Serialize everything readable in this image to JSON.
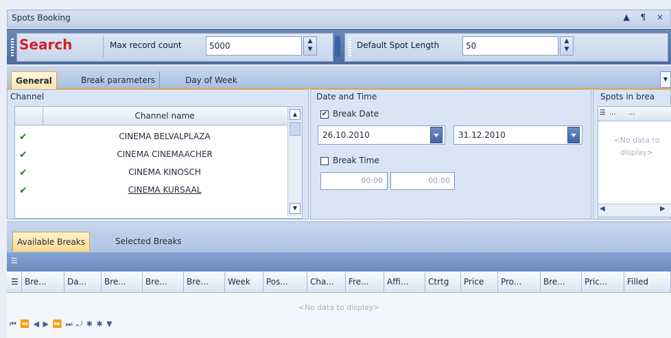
{
  "window": {
    "title": "Spots Booking",
    "controls": "▲ ¶ ×"
  },
  "toolbar": {
    "search_label": "Search",
    "max_record_label": "Max record count",
    "max_record_value": "5000",
    "default_spot_label": "Default Spot Length",
    "default_spot_value": "50"
  },
  "tabs": [
    "General",
    "Break parameters",
    "Day of Week"
  ],
  "channel_panel": {
    "title": "Channel",
    "column_header": "Channel name",
    "rows": [
      "CINEMA BELVALPLAZA",
      "CINEMA CINEMAACHER",
      "CINEMA KINOSCH",
      "CINEMA KURSAAL"
    ]
  },
  "date_panel": {
    "title": "Date and Time",
    "break_date_label": "Break Date",
    "from_date": "26.10.2010",
    "to_date": "31.12.2010",
    "break_time_label": "Break Time",
    "from_time": "00:00",
    "to_time": "00:00"
  },
  "spots_panel": {
    "title": "Spots in brea",
    "col1": "",
    "col2": "...",
    "col3": "...",
    "nodata": "<No data to display>"
  },
  "bottom_tabs": [
    "Available Breaks",
    "Selected Breaks"
  ],
  "grid_columns": [
    "Bre...",
    "Da...",
    "Bre...",
    "Bre...",
    "Bre...",
    "Week",
    "Pos...",
    "Cha...",
    "Fre...",
    "Affi...",
    "Ctrtg",
    "Price",
    "Pro...",
    "Bre...",
    "Pric...",
    "Filled"
  ],
  "grid_nodata": "<No data to display>",
  "navigator": "⏮ ⏪ ◀ ▶ ⏩ ⏭ ⤾ ✱ ✱ ▼"
}
